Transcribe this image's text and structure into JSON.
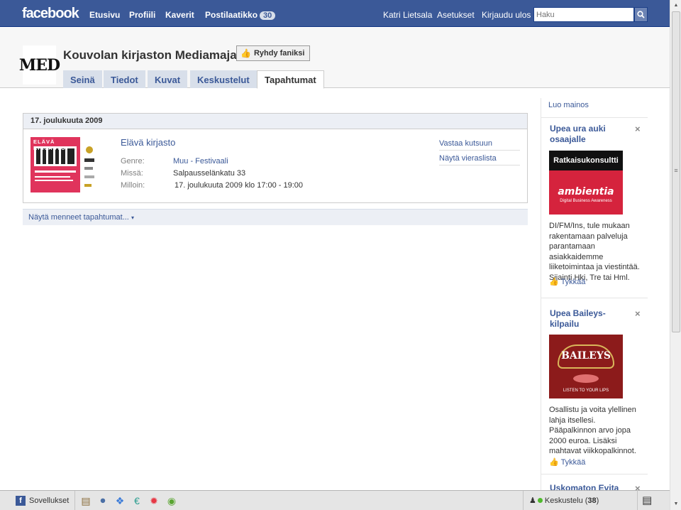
{
  "topbar": {
    "logo": "facebook",
    "nav": [
      "Etusivu",
      "Profiili",
      "Kaverit",
      "Postilaatikko"
    ],
    "inbox_count": "30",
    "user": "Katri Lietsala",
    "settings": "Asetukset",
    "logout": "Kirjaudu ulos",
    "search_placeholder": "Haku"
  },
  "page": {
    "logo_text": "MED",
    "name": "Kouvolan kirjaston Mediamaja",
    "fan_button": "Ryhdy faniksi",
    "tabs": [
      "Seinä",
      "Tiedot",
      "Kuvat",
      "Keskustelut",
      "Tapahtumat"
    ],
    "active_tab": "Tapahtumat"
  },
  "events": {
    "date": "17. joulukuuta 2009",
    "event": {
      "title": "Elävä kirjasto",
      "fields": [
        {
          "label": "Genre:",
          "value": "Muu - Festivaali",
          "link": true
        },
        {
          "label": "Missä:",
          "value": "Salpausselänkatu 33",
          "link": false
        },
        {
          "label": "Milloin:",
          "value": "17. joulukuuta 2009 klo 17:00 - 19:00",
          "link": false
        }
      ],
      "thumb_text": "ELÄVÄ KIRJASTO",
      "actions": [
        "Vastaa kutsuun",
        "Näytä vieraslista"
      ]
    },
    "past_link": "Näytä menneet tapahtumat...",
    "colors": {
      "thumb": "#e0345c"
    }
  },
  "sidebar": {
    "create_ad": "Luo mainos",
    "ads": [
      {
        "title": "Upea ura auki osaajalle",
        "image_caption": "Ratkaisukonsultti",
        "image_brand": "ambientia",
        "image_tag": "Digital Business Awareness",
        "text": "DI/FM/Ins, tule mukaan rakentamaan palveluja parantamaan asiakkaidemme liiketoimintaa ja viestintää. Sijainti Hki, Tre tai Hml.",
        "like": "Tykkää"
      },
      {
        "title": "Upea Baileys-kilpailu",
        "image_brand": "BAILEYS",
        "image_tag": "LISTEN TO YOUR LIPS",
        "text": "Osallistu ja voita ylellinen lahja itsellesi. Pääpalkinnon arvo jopa 2000 euroa. Lisäksi mahtavat viikkopalkinnot.",
        "like": "Tykkää"
      },
      {
        "title": "Uskomaton Evita"
      }
    ]
  },
  "bottombar": {
    "apps": "Sovellukset",
    "chat": "Keskustelu",
    "chat_count": "38"
  }
}
